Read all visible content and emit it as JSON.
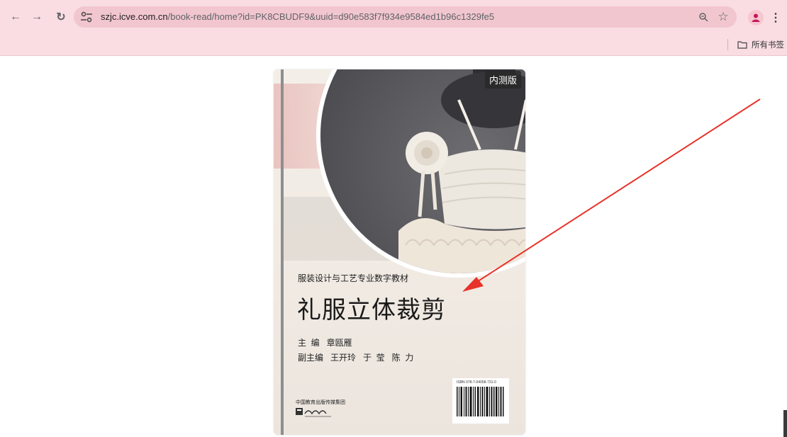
{
  "browser": {
    "url_host": "szjc.icve.com.cn",
    "url_path": "/book-read/home?id=PK8CBUDF9&uuid=d90e583f7f934e9584ed1b96c1329fe5",
    "bookmarks_folder": "所有书签",
    "icons": [
      "back-icon",
      "forward-icon",
      "reload-icon",
      "site-settings-icon",
      "zoom-icon",
      "star-icon",
      "profile-icon",
      "menu-icon",
      "folder-icon"
    ]
  },
  "cover": {
    "badge": "内测版",
    "subtitle": "服装设计与工艺专业数字教材",
    "title": "礼服立体裁剪",
    "editor_line": "主  编   章瓯雁",
    "associate_editors_line": "副主编   王开玲   于  莹   陈  力",
    "publisher_group": "中国教育出版传媒集团",
    "isbn_text": "ISBN 978-7-04058-731-0"
  },
  "colors": {
    "chrome_bg": "#f9dde2",
    "omnibox_bg": "#f2c6cf",
    "arrow": "#e8332a"
  }
}
